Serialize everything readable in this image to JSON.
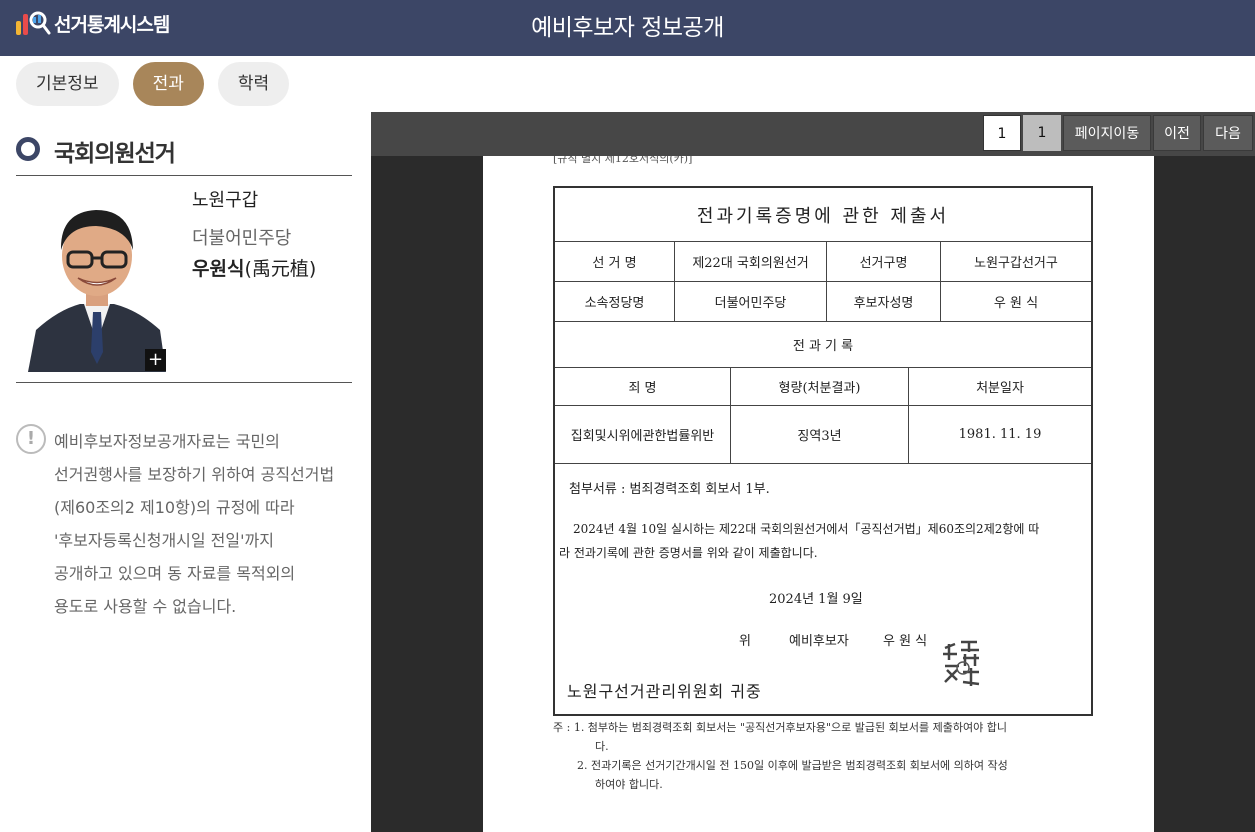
{
  "header": {
    "logo_text": "선거통계시스템",
    "title": "예비후보자 정보공개",
    "colors": {
      "bar": "#3c4666"
    }
  },
  "tabs": [
    {
      "label": "기본정보",
      "active": false
    },
    {
      "label": "전과",
      "active": true
    },
    {
      "label": "학력",
      "active": false
    }
  ],
  "left": {
    "section_title": "국회의원선거",
    "candidate": {
      "district": "노원구갑",
      "party": "더불어민주당",
      "name": "우원식",
      "hanja": "(禹元植)",
      "photo_plus": "+"
    },
    "notice_icon": "!",
    "notice_lines": [
      "예비후보자정보공개자료는 국민의",
      "선거권행사를 보장하기 위하여 공직선거법",
      "(제60조의2 제10항)의 규정에 따라",
      "'후보자등록신청개시일 전일'까지",
      "공개하고 있으며 동 자료를 목적외의",
      "용도로 사용할 수 없습니다."
    ]
  },
  "viewer": {
    "current_page": "1",
    "total_pages": "1",
    "move_label": "페이지이동",
    "prev_label": "이전",
    "next_label": "다음"
  },
  "document": {
    "form_header": "[규칙 별지 제12호서식의(카)]",
    "title": "전과기록증명에 관한 제출서",
    "election_label": "선 거 명",
    "election_value": "제22대 국회의원선거",
    "district_label": "선거구명",
    "district_value": "노원구갑선거구",
    "party_label": "소속정당명",
    "party_value": "더불어민주당",
    "candidate_label": "후보자성명",
    "candidate_value": "우 원 식",
    "record_title": "전 과 기 록",
    "col_crime": "죄 명",
    "col_sentence": "형량(처분결과)",
    "col_date": "처분일자",
    "crime": "집회및시위에관한법률위반",
    "sentence": "징역3년",
    "date": "1981. 11. 19",
    "attachment": "첨부서류 : 범죄경력조회 회보서 1부.",
    "body_line1": "2024년 4월 10일 실시하는 제22대 국회의원선거에서「공직선거법」제60조의2제2항에 따",
    "body_line2": "라 전과기록에 관한 증명서를 위와 같이 제출합니다.",
    "sign_date": "2024년    1월   9일",
    "sign_prefix": "위",
    "sign_role": "예비후보자",
    "sign_name": "우 원 식",
    "addressee": "노원구선거관리위원회   귀중",
    "note1_a": "주 : 1. 첨부하는 범죄경력조회 회보서는 \"공직선거후보자용\"으로 발급된 회보서를 제출하여야 합니",
    "note1_b": "다.",
    "note2_a": "2. 전과기록은 선거기간개시일 전 150일 이후에 발급받은 범죄경력조회 회보서에 의하여 작성",
    "note2_b": "하여야 합니다."
  }
}
